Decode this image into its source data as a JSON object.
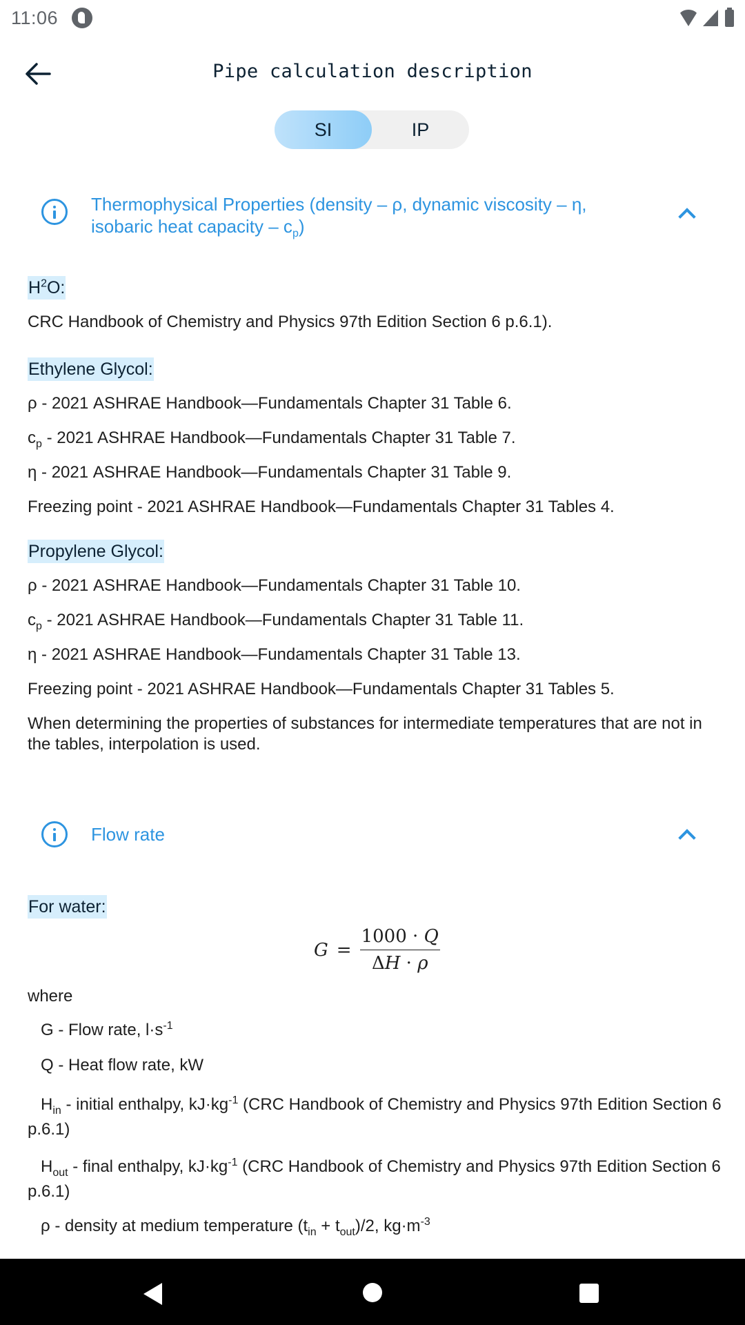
{
  "status_bar": {
    "time": "11:06",
    "icons": [
      "app-notification-icon",
      "wifi-icon",
      "signal-icon",
      "battery-icon"
    ]
  },
  "app_bar": {
    "back_icon": "arrow-left-icon",
    "title": "Pipe calculation description"
  },
  "unit_toggle": {
    "options": [
      "SI",
      "IP"
    ],
    "selected": "SI"
  },
  "colors": {
    "accent": "#2d94e0",
    "toggle_active_start": "#bfe2fb",
    "toggle_active_end": "#8ecdf7",
    "toggle_bg": "#f0f0f0",
    "label_highlight": "#d6eefc",
    "title_text": "#0d2233"
  },
  "sections": [
    {
      "title_line1": "Thermophysical Properties (density – ρ, dynamic viscosity – η,",
      "title_line2_prefix": "isobaric heat capacity – c",
      "title_line2_sub": "p",
      "title_line2_suffix": ")",
      "icon": "info-icon",
      "expanded": true,
      "groups": [
        {
          "label_prefix": "H",
          "label_sup": "2",
          "label_suffix": "O:",
          "lines": [
            "CRC Handbook of Chemistry and Physics 97th Edition Section 6 p.6.1)."
          ]
        },
        {
          "label": "Ethylene Glycol:",
          "lines": [
            {
              "sym": "ρ ",
              "text": " - 2021 ASHRAE Handbook—Fundamentals Chapter 31 Table 6."
            },
            {
              "sym": "c",
              "sub": "p",
              "text": " - 2021 ASHRAE Handbook—Fundamentals Chapter 31 Table 7."
            },
            {
              "sym": "η",
              "text": " - 2021 ASHRAE Handbook—Fundamentals Chapter 31 Table 9."
            },
            {
              "text": "Freezing point - 2021 ASHRAE Handbook—Fundamentals  Chapter 31 Tables 4."
            }
          ]
        },
        {
          "label": "Propylene Glycol:",
          "lines": [
            {
              "sym": "ρ ",
              "text": " - 2021 ASHRAE Handbook—Fundamentals Chapter 31 Table 10."
            },
            {
              "sym": "c",
              "sub": "p",
              "text": " - 2021 ASHRAE Handbook—Fundamentals Chapter 31 Table 11."
            },
            {
              "sym": "η",
              "text": " - 2021 ASHRAE Handbook—Fundamentals Chapter 31 Table 13."
            },
            {
              "text": "Freezing point - 2021 ASHRAE Handbook—Fundamentals  Chapter 31 Tables 5."
            }
          ]
        }
      ],
      "note": "When determining the properties of substances for intermediate temperatures that are not in the tables, interpolation is used."
    },
    {
      "title": "Flow rate",
      "icon": "info-icon",
      "expanded": true,
      "label": "For water:",
      "formula": {
        "lhs": "G",
        "eq": "=",
        "num_const": "1000",
        "num_op": " · ",
        "num_var": "Q",
        "den_delta": "Δ",
        "den_var1": "H",
        "den_op": " · ",
        "den_var2": "ρ"
      },
      "where": "where",
      "definitions": [
        {
          "sym": "G",
          "text": " - Flow rate, l·s",
          "sup": "-1"
        },
        {
          "sym": "Q",
          "text": " - Heat flow rate, kW"
        },
        {
          "sym": "H",
          "sub": "in",
          "text": " - initial enthalpy, kJ·kg",
          "sup": "-1",
          "tail": " (CRC Handbook of Chemistry and Physics 97th Edition Section 6 p.6.1)"
        },
        {
          "sym": "H",
          "sub": "out",
          "text": " - final enthalpy, kJ·kg",
          "sup": "-1",
          "tail": " (CRC Handbook of Chemistry and Physics 97th Edition Section 6 p.6.1)"
        },
        {
          "sym": "ρ",
          "text": " - density at medium temperature (t",
          "sub2": "in",
          "mid": " + t",
          "sub3": "out",
          "text2": ")/2, kg·m",
          "sup": "-3"
        }
      ]
    }
  ],
  "nav_bar": {
    "buttons": [
      "back",
      "home",
      "recents"
    ]
  }
}
